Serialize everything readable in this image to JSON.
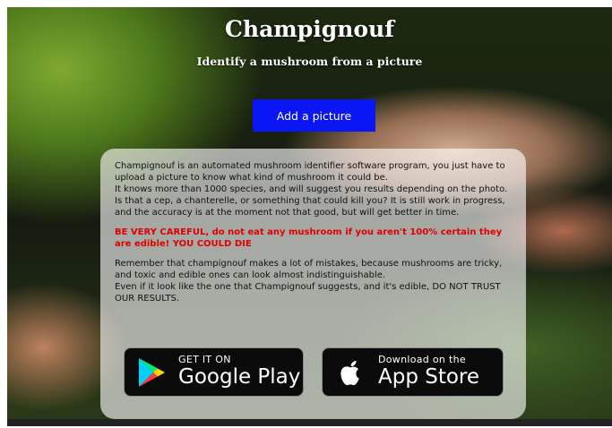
{
  "header": {
    "title": "Champignouf",
    "subtitle": "Identify a mushroom from a picture"
  },
  "upload": {
    "button_label": "Add a picture"
  },
  "info": {
    "intro_lines": [
      "Champignouf is an automated mushroom identifier software program, you just have to upload a picture to know what kind of mushroom it could be.",
      "It knows more than 1000 species, and will suggest you results depending on the photo.",
      "Is that a cep, a chanterelle, or something that could kill you? It is still work in progress, and the accuracy is at the moment not that good, but will get better in time."
    ],
    "warning": "BE VERY CAREFUL, do not eat any mushroom if you aren't 100% certain they are edible! YOU COULD DIE",
    "note_lines": [
      "Remember that champignouf makes a lot of mistakes, because mushrooms are tricky, and toxic and edible ones can look almost indistinguishable.",
      "Even if it look like the one that Champignouf suggests, and it's edible, DO NOT TRUST OUR RESULTS."
    ]
  },
  "stores": {
    "google_play": {
      "small_text": "GET IT ON",
      "big_text": "Google Play",
      "icon": "google-play-icon"
    },
    "app_store": {
      "small_text": "Download on the",
      "big_text": "App Store",
      "icon": "apple-icon"
    }
  },
  "colors": {
    "button_blue": "#0a17f4",
    "warning_red": "#e00000",
    "title_white": "#ffffff",
    "store_badge_black": "#0b0b0b"
  }
}
